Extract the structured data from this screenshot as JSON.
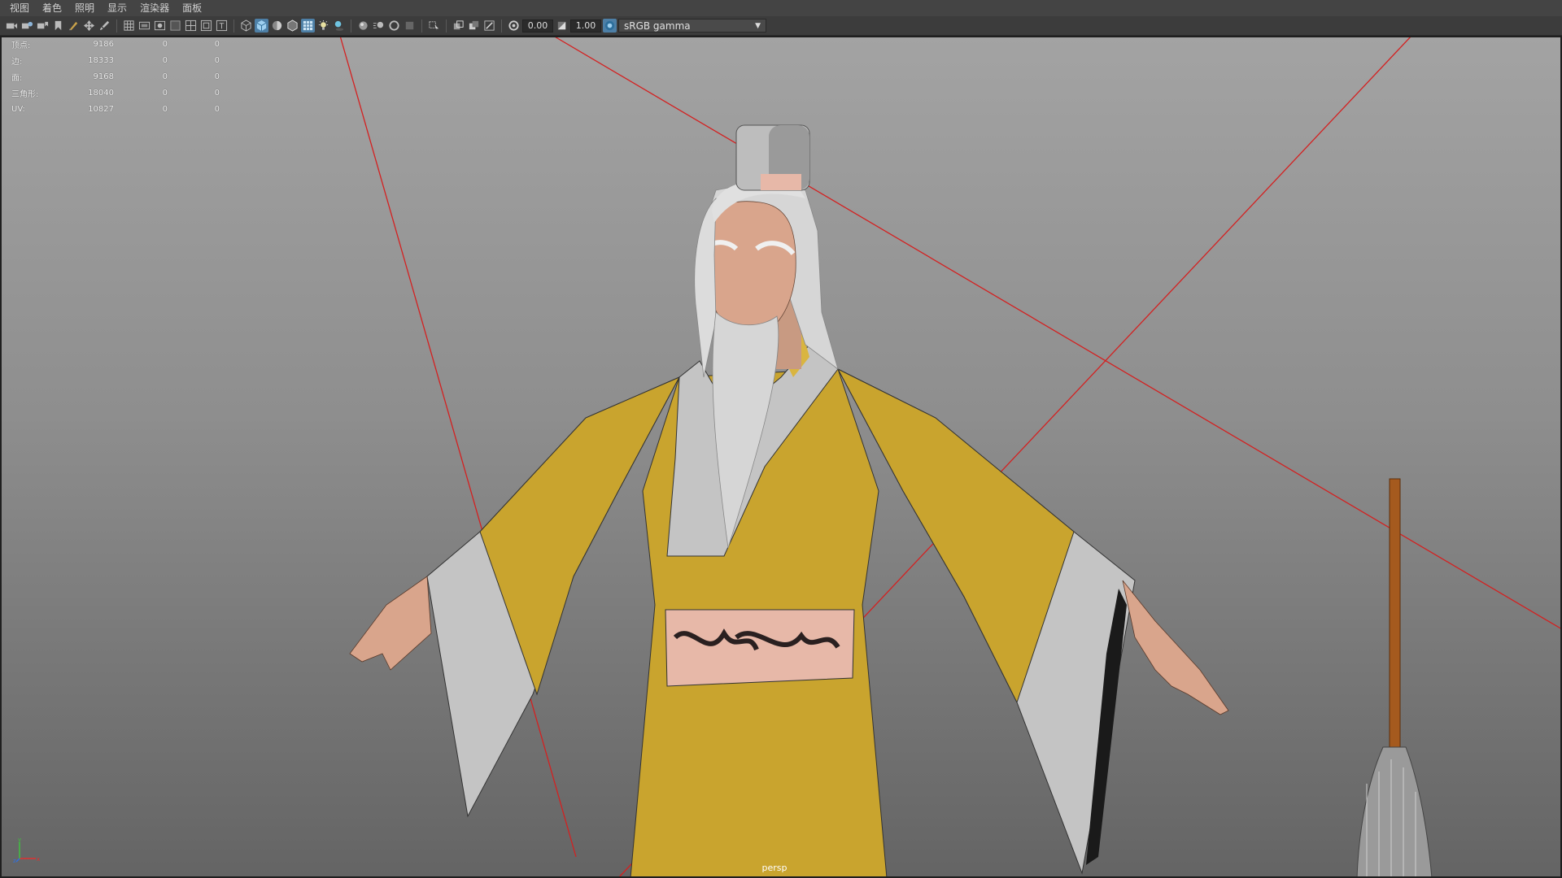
{
  "menu": [
    "视图",
    "着色",
    "照明",
    "显示",
    "渲染器",
    "面板"
  ],
  "toolbar": {
    "exposure": "0.00",
    "gamma": "1.00",
    "color_space": "sRGB gamma"
  },
  "heads_up": {
    "rows": [
      {
        "label": "顶点:",
        "value": "9186",
        "c2": "0",
        "c3": "0"
      },
      {
        "label": "边:",
        "value": "18333",
        "c2": "0",
        "c3": "0"
      },
      {
        "label": "面:",
        "value": "9168",
        "c2": "0",
        "c3": "0"
      },
      {
        "label": "三角形:",
        "value": "18040",
        "c2": "0",
        "c3": "0"
      },
      {
        "label": "UV:",
        "value": "10827",
        "c2": "0",
        "c3": "0"
      }
    ]
  },
  "viewport": {
    "camera": "persp",
    "axes": {
      "x": "x",
      "y": "y",
      "z": "z"
    }
  },
  "colors": {
    "robe": "#c9a42e",
    "sleeve_cuff": "#c4c4c4",
    "belt": "#e7b8a8",
    "skin": "#d9a58c",
    "hair": "#d6d6d6",
    "frustum_line": "#d42020",
    "whisk_handle": "#a55a1e"
  }
}
